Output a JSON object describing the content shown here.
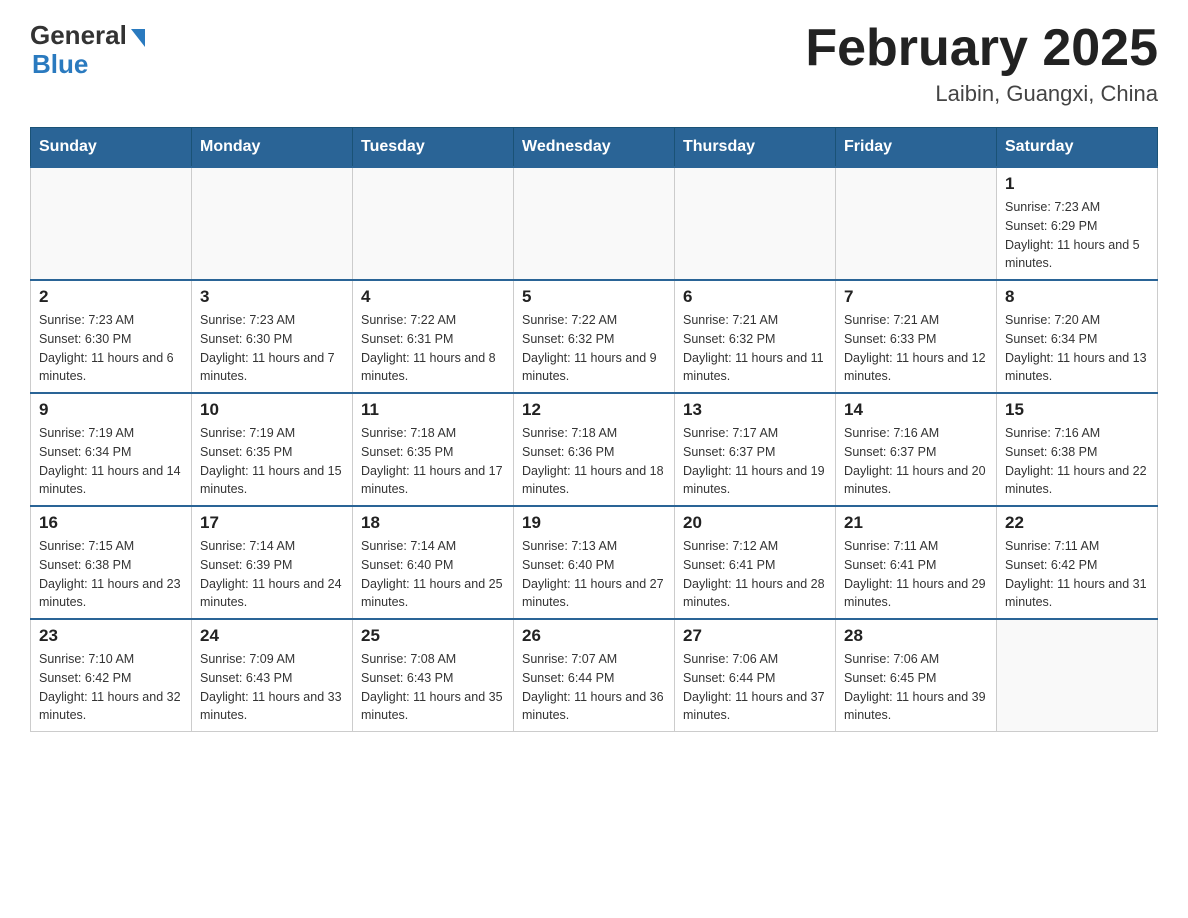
{
  "header": {
    "logo_general": "General",
    "logo_blue": "Blue",
    "month_title": "February 2025",
    "location": "Laibin, Guangxi, China"
  },
  "days_of_week": [
    "Sunday",
    "Monday",
    "Tuesday",
    "Wednesday",
    "Thursday",
    "Friday",
    "Saturday"
  ],
  "weeks": [
    [
      {
        "day": "",
        "info": ""
      },
      {
        "day": "",
        "info": ""
      },
      {
        "day": "",
        "info": ""
      },
      {
        "day": "",
        "info": ""
      },
      {
        "day": "",
        "info": ""
      },
      {
        "day": "",
        "info": ""
      },
      {
        "day": "1",
        "info": "Sunrise: 7:23 AM\nSunset: 6:29 PM\nDaylight: 11 hours and 5 minutes."
      }
    ],
    [
      {
        "day": "2",
        "info": "Sunrise: 7:23 AM\nSunset: 6:30 PM\nDaylight: 11 hours and 6 minutes."
      },
      {
        "day": "3",
        "info": "Sunrise: 7:23 AM\nSunset: 6:30 PM\nDaylight: 11 hours and 7 minutes."
      },
      {
        "day": "4",
        "info": "Sunrise: 7:22 AM\nSunset: 6:31 PM\nDaylight: 11 hours and 8 minutes."
      },
      {
        "day": "5",
        "info": "Sunrise: 7:22 AM\nSunset: 6:32 PM\nDaylight: 11 hours and 9 minutes."
      },
      {
        "day": "6",
        "info": "Sunrise: 7:21 AM\nSunset: 6:32 PM\nDaylight: 11 hours and 11 minutes."
      },
      {
        "day": "7",
        "info": "Sunrise: 7:21 AM\nSunset: 6:33 PM\nDaylight: 11 hours and 12 minutes."
      },
      {
        "day": "8",
        "info": "Sunrise: 7:20 AM\nSunset: 6:34 PM\nDaylight: 11 hours and 13 minutes."
      }
    ],
    [
      {
        "day": "9",
        "info": "Sunrise: 7:19 AM\nSunset: 6:34 PM\nDaylight: 11 hours and 14 minutes."
      },
      {
        "day": "10",
        "info": "Sunrise: 7:19 AM\nSunset: 6:35 PM\nDaylight: 11 hours and 15 minutes."
      },
      {
        "day": "11",
        "info": "Sunrise: 7:18 AM\nSunset: 6:35 PM\nDaylight: 11 hours and 17 minutes."
      },
      {
        "day": "12",
        "info": "Sunrise: 7:18 AM\nSunset: 6:36 PM\nDaylight: 11 hours and 18 minutes."
      },
      {
        "day": "13",
        "info": "Sunrise: 7:17 AM\nSunset: 6:37 PM\nDaylight: 11 hours and 19 minutes."
      },
      {
        "day": "14",
        "info": "Sunrise: 7:16 AM\nSunset: 6:37 PM\nDaylight: 11 hours and 20 minutes."
      },
      {
        "day": "15",
        "info": "Sunrise: 7:16 AM\nSunset: 6:38 PM\nDaylight: 11 hours and 22 minutes."
      }
    ],
    [
      {
        "day": "16",
        "info": "Sunrise: 7:15 AM\nSunset: 6:38 PM\nDaylight: 11 hours and 23 minutes."
      },
      {
        "day": "17",
        "info": "Sunrise: 7:14 AM\nSunset: 6:39 PM\nDaylight: 11 hours and 24 minutes."
      },
      {
        "day": "18",
        "info": "Sunrise: 7:14 AM\nSunset: 6:40 PM\nDaylight: 11 hours and 25 minutes."
      },
      {
        "day": "19",
        "info": "Sunrise: 7:13 AM\nSunset: 6:40 PM\nDaylight: 11 hours and 27 minutes."
      },
      {
        "day": "20",
        "info": "Sunrise: 7:12 AM\nSunset: 6:41 PM\nDaylight: 11 hours and 28 minutes."
      },
      {
        "day": "21",
        "info": "Sunrise: 7:11 AM\nSunset: 6:41 PM\nDaylight: 11 hours and 29 minutes."
      },
      {
        "day": "22",
        "info": "Sunrise: 7:11 AM\nSunset: 6:42 PM\nDaylight: 11 hours and 31 minutes."
      }
    ],
    [
      {
        "day": "23",
        "info": "Sunrise: 7:10 AM\nSunset: 6:42 PM\nDaylight: 11 hours and 32 minutes."
      },
      {
        "day": "24",
        "info": "Sunrise: 7:09 AM\nSunset: 6:43 PM\nDaylight: 11 hours and 33 minutes."
      },
      {
        "day": "25",
        "info": "Sunrise: 7:08 AM\nSunset: 6:43 PM\nDaylight: 11 hours and 35 minutes."
      },
      {
        "day": "26",
        "info": "Sunrise: 7:07 AM\nSunset: 6:44 PM\nDaylight: 11 hours and 36 minutes."
      },
      {
        "day": "27",
        "info": "Sunrise: 7:06 AM\nSunset: 6:44 PM\nDaylight: 11 hours and 37 minutes."
      },
      {
        "day": "28",
        "info": "Sunrise: 7:06 AM\nSunset: 6:45 PM\nDaylight: 11 hours and 39 minutes."
      },
      {
        "day": "",
        "info": ""
      }
    ]
  ]
}
